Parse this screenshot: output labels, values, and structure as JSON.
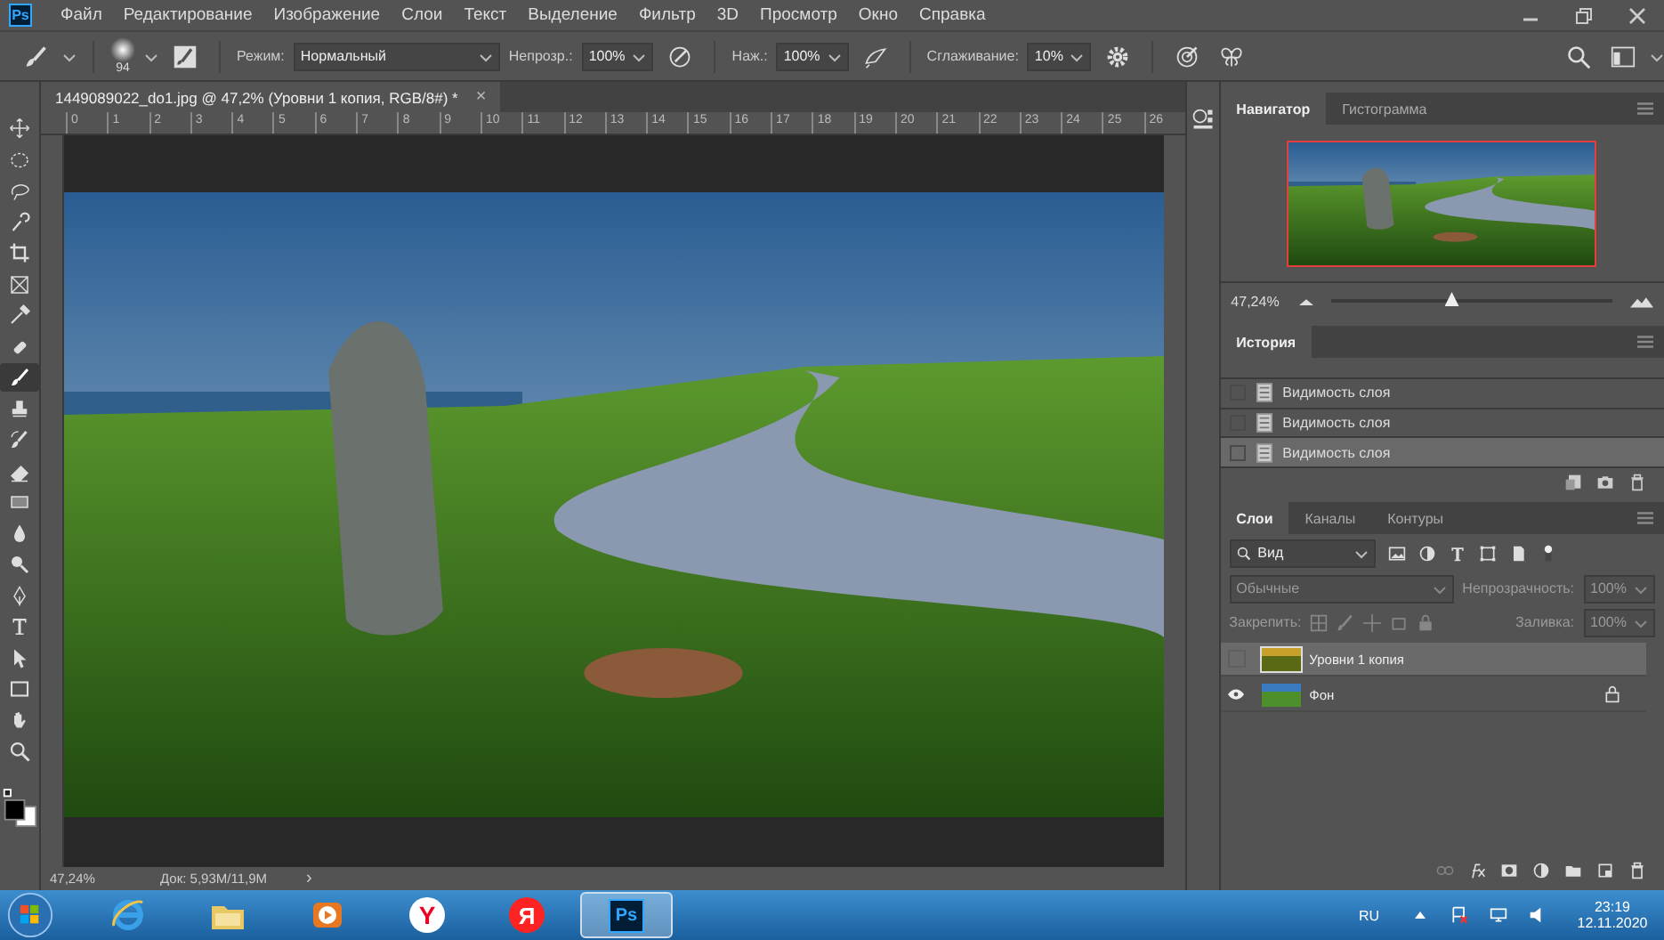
{
  "app": {
    "logo": "Ps"
  },
  "menu": [
    "Файл",
    "Редактирование",
    "Изображение",
    "Слои",
    "Текст",
    "Выделение",
    "Фильтр",
    "3D",
    "Просмотр",
    "Окно",
    "Справка"
  ],
  "options_bar": {
    "brush_size": "94",
    "mode_label": "Режим:",
    "mode_value": "Нормальный",
    "opacity_label": "Непрозр.:",
    "opacity_value": "100%",
    "pressure_label": "Наж.:",
    "pressure_value": "100%",
    "smoothing_label": "Сглаживание:",
    "smoothing_value": "10%"
  },
  "tools": [
    {
      "kind": "move",
      "selected": false
    },
    {
      "kind": "marquee",
      "selected": false
    },
    {
      "kind": "lasso",
      "selected": false
    },
    {
      "kind": "quick-select",
      "selected": false
    },
    {
      "kind": "crop",
      "selected": false
    },
    {
      "kind": "frame",
      "selected": false
    },
    {
      "kind": "eyedropper",
      "selected": false
    },
    {
      "kind": "healing",
      "selected": false
    },
    {
      "kind": "brush",
      "selected": true
    },
    {
      "kind": "stamp",
      "selected": false
    },
    {
      "kind": "history-brush",
      "selected": false
    },
    {
      "kind": "eraser",
      "selected": false
    },
    {
      "kind": "gradient",
      "selected": false
    },
    {
      "kind": "blur",
      "selected": false
    },
    {
      "kind": "dodge",
      "selected": false
    },
    {
      "kind": "pen",
      "selected": false
    },
    {
      "kind": "type",
      "selected": false
    },
    {
      "kind": "path-select",
      "selected": false
    },
    {
      "kind": "rectangle",
      "selected": false
    },
    {
      "kind": "hand",
      "selected": false
    },
    {
      "kind": "zoom",
      "selected": false
    }
  ],
  "document": {
    "tab_title": "1449089022_do1.jpg @ 47,2% (Уровни 1 копия, RGB/8#) *",
    "close": "×",
    "ruler_marks": [
      "0",
      "1",
      "2",
      "3",
      "4",
      "5",
      "6",
      "7",
      "8",
      "9",
      "10",
      "11",
      "12",
      "13",
      "14",
      "15",
      "16",
      "17",
      "18",
      "19",
      "20",
      "21",
      "22",
      "23",
      "24",
      "25",
      "26"
    ]
  },
  "status_bar": {
    "zoom": "47,24%",
    "doc_info": "Док: 5,93M/11,9M",
    "arrow": "›"
  },
  "navigator": {
    "tabs": [
      {
        "label": "Навигатор",
        "selected": true
      },
      {
        "label": "Гистограмма",
        "selected": false
      }
    ],
    "zoom": "47,24%",
    "level": 0.43
  },
  "history": {
    "tabs": [
      {
        "label": "История",
        "selected": true
      }
    ],
    "items": [
      {
        "label": "Видимость слоя",
        "selected": false
      },
      {
        "label": "Видимость слоя",
        "selected": false
      },
      {
        "label": "Видимость слоя",
        "selected": true
      }
    ]
  },
  "layers_panel": {
    "tabs": [
      {
        "label": "Слои",
        "selected": true
      },
      {
        "label": "Каналы",
        "selected": false
      },
      {
        "label": "Контуры",
        "selected": false
      }
    ],
    "filter": "Вид",
    "blend_mode": "Обычные",
    "opacity_label": "Непрозрачность:",
    "opacity_value": "100%",
    "lock_label": "Закрепить:",
    "fill_label": "Заливка:",
    "fill_value": "100%",
    "controls_disabled": true,
    "layers": [
      {
        "name": "Уровни 1 копия",
        "visible": false,
        "selected": true,
        "locked": false,
        "kind": "adjusted"
      },
      {
        "name": "Фон",
        "visible": true,
        "selected": false,
        "locked": true,
        "kind": "photo"
      }
    ]
  },
  "taskbar": {
    "apps": [
      {
        "kind": "ie",
        "selected": false
      },
      {
        "kind": "explorer",
        "selected": false
      },
      {
        "kind": "media",
        "selected": false
      },
      {
        "kind": "yandex-browser",
        "label": "Y",
        "selected": false
      },
      {
        "kind": "yandex",
        "label": "Я",
        "selected": false
      },
      {
        "kind": "photoshop",
        "label": "Ps",
        "selected": true
      }
    ],
    "language": "RU",
    "time": "23:19",
    "date": "12.11.2020"
  }
}
